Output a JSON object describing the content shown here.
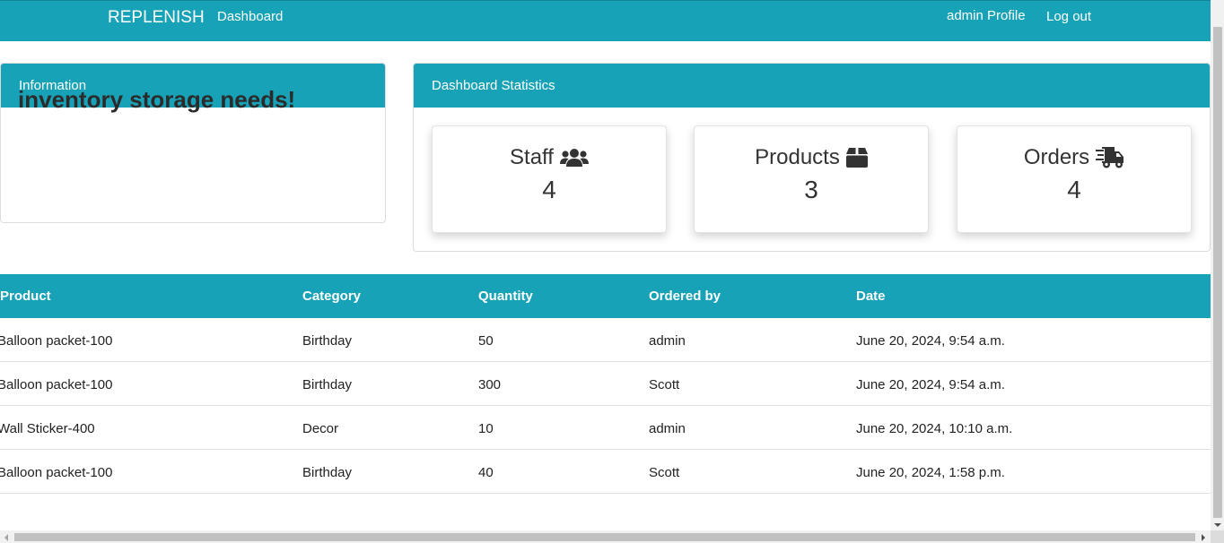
{
  "navbar": {
    "brand": "REPLENISH",
    "dashboard_link": "Dashboard",
    "profile_link": "admin Profile",
    "logout_link": "Log out",
    "color": "#17a2b8"
  },
  "info_card": {
    "header": "Information",
    "text": "inventory storage needs!"
  },
  "stats_card": {
    "header": "Dashboard Statistics",
    "stats": [
      {
        "label": "Staff",
        "value": "4",
        "icon": "users-icon"
      },
      {
        "label": "Products",
        "value": "3",
        "icon": "box-icon"
      },
      {
        "label": "Orders",
        "value": "4",
        "icon": "shipping-truck-icon"
      }
    ]
  },
  "orders_table": {
    "columns": [
      "Product",
      "Category",
      "Quantity",
      "Ordered by",
      "Date"
    ],
    "rows": [
      [
        "Balloon packet-100",
        "Birthday",
        "50",
        "admin",
        "June 20, 2024, 9:54 a.m."
      ],
      [
        "Balloon packet-100",
        "Birthday",
        "300",
        "Scott",
        "June 20, 2024, 9:54 a.m."
      ],
      [
        "Wall Sticker-400",
        "Decor",
        "10",
        "admin",
        "June 20, 2024, 10:10 a.m."
      ],
      [
        "Balloon packet-100",
        "Birthday",
        "40",
        "Scott",
        "June 20, 2024, 1:58 p.m."
      ]
    ]
  }
}
